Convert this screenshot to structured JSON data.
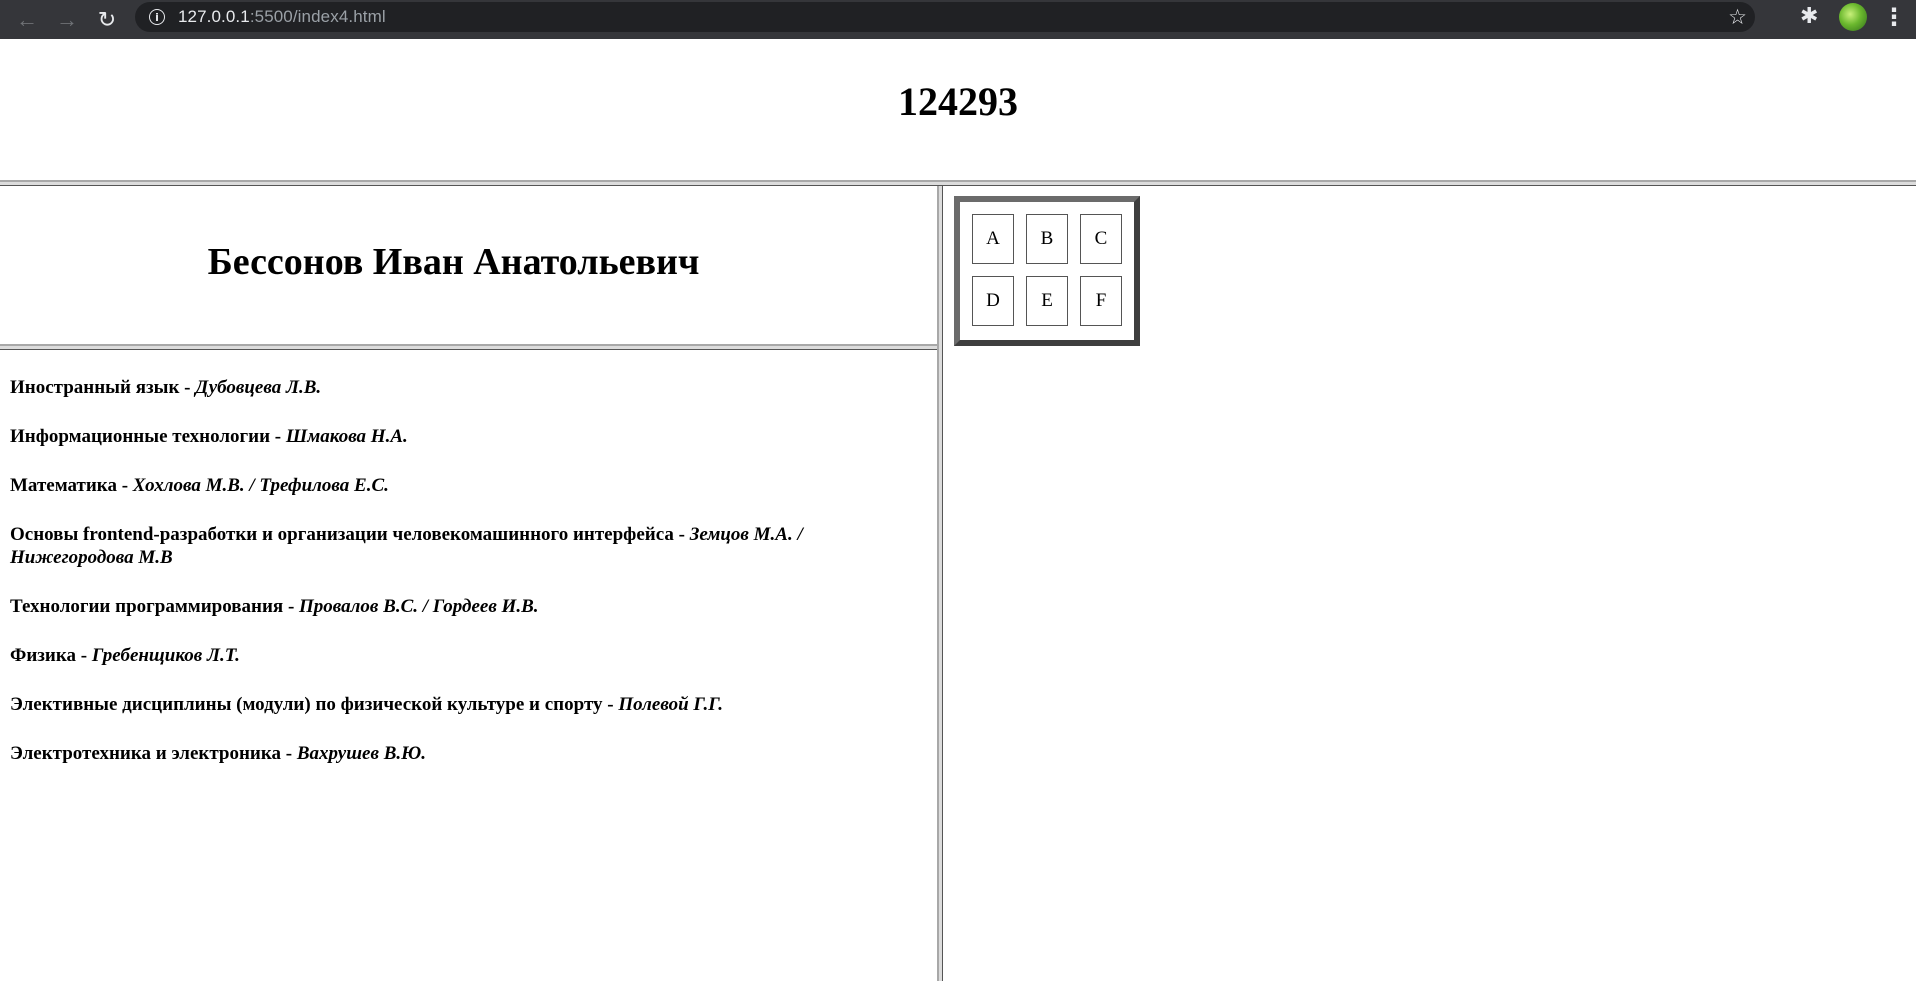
{
  "browser": {
    "url_host": "127.0.0.1",
    "url_rest": ":5500/index4.html",
    "icons": [
      "back-arrow-icon",
      "forward-arrow-icon",
      "reload-icon",
      "info-icon",
      "star-icon",
      "extensions-icon",
      "profile-avatar",
      "menu-icon"
    ]
  },
  "header": {
    "title": "124293"
  },
  "student": {
    "name": "Бессонов Иван Анатольевич"
  },
  "subjects": [
    {
      "name": "Иностранный язык",
      "sep": " - ",
      "teacher": "Дубовцева Л.В."
    },
    {
      "name": "Информационные технологии",
      "sep": " - ",
      "teacher": "Шмакова Н.А."
    },
    {
      "name": "Математика",
      "sep": " - ",
      "teacher": "Хохлова М.В. / Трефилова Е.С."
    },
    {
      "name": "Основы frontend-разработки и организации человекомашинного интерфейса",
      "sep": " - ",
      "teacher": "Земцов М.А. / Нижегородова М.В"
    },
    {
      "name": "Технологии программирования",
      "sep": " - ",
      "teacher": "Провалов В.С. / Гордеев И.В."
    },
    {
      "name": "Физика",
      "sep": " - ",
      "teacher": "Гребенщиков Л.Т."
    },
    {
      "name": "Элективные дисциплины (модули) по физической культуре и спорту",
      "sep": " - ",
      "teacher": "Полевой Г.Г."
    },
    {
      "name": "Электротехника и электроника",
      "sep": " - ",
      "teacher": "Вахрушев В.Ю."
    }
  ],
  "grid": {
    "cells": [
      "A",
      "B",
      "C",
      "D",
      "E",
      "F"
    ]
  }
}
